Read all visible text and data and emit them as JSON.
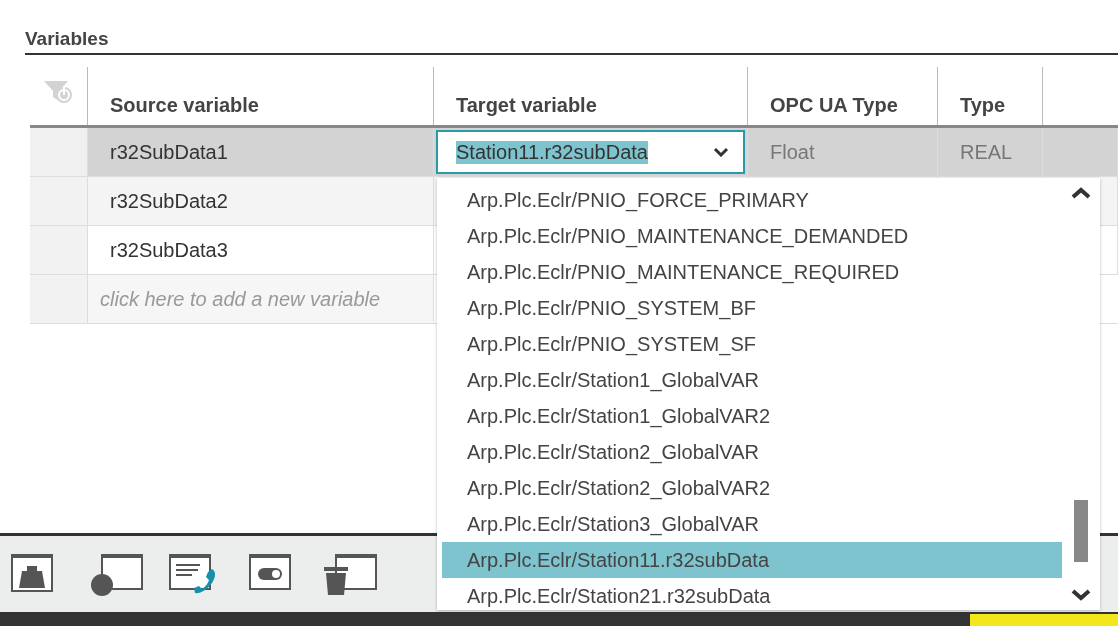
{
  "section": {
    "title": "Variables"
  },
  "table": {
    "columns": [
      "Source variable",
      "Target variable",
      "OPC UA Type",
      "Type"
    ],
    "rows": [
      {
        "source": "r32SubData1",
        "target": "Station11.r32subData",
        "opc_ua_type": "Float",
        "type": "REAL",
        "selected": true
      },
      {
        "source": "r32SubData2",
        "selected": false
      },
      {
        "source": "r32SubData3",
        "selected": false
      }
    ],
    "add_row_placeholder": "click here to add a new variable"
  },
  "target_dropdown": {
    "options": [
      {
        "label": "Arp.Plc.Eclr/PNIO_FORCE_PRIMARY",
        "selected": false
      },
      {
        "label": "Arp.Plc.Eclr/PNIO_MAINTENANCE_DEMANDED",
        "selected": false
      },
      {
        "label": "Arp.Plc.Eclr/PNIO_MAINTENANCE_REQUIRED",
        "selected": false
      },
      {
        "label": "Arp.Plc.Eclr/PNIO_SYSTEM_BF",
        "selected": false
      },
      {
        "label": "Arp.Plc.Eclr/PNIO_SYSTEM_SF",
        "selected": false
      },
      {
        "label": "Arp.Plc.Eclr/Station1_GlobalVAR",
        "selected": false
      },
      {
        "label": "Arp.Plc.Eclr/Station1_GlobalVAR2",
        "selected": false
      },
      {
        "label": "Arp.Plc.Eclr/Station2_GlobalVAR",
        "selected": false
      },
      {
        "label": "Arp.Plc.Eclr/Station2_GlobalVAR2",
        "selected": false
      },
      {
        "label": "Arp.Plc.Eclr/Station3_GlobalVAR",
        "selected": false
      },
      {
        "label": "Arp.Plc.Eclr/Station11.r32subData",
        "selected": true
      },
      {
        "label": "Arp.Plc.Eclr/Station21.r32subData",
        "selected": false
      }
    ]
  },
  "toolbar": {
    "tools": [
      {
        "kind": "weight"
      },
      {
        "kind": "circle"
      },
      {
        "kind": "phone"
      },
      {
        "kind": "toggle"
      },
      {
        "kind": "trash"
      }
    ]
  }
}
